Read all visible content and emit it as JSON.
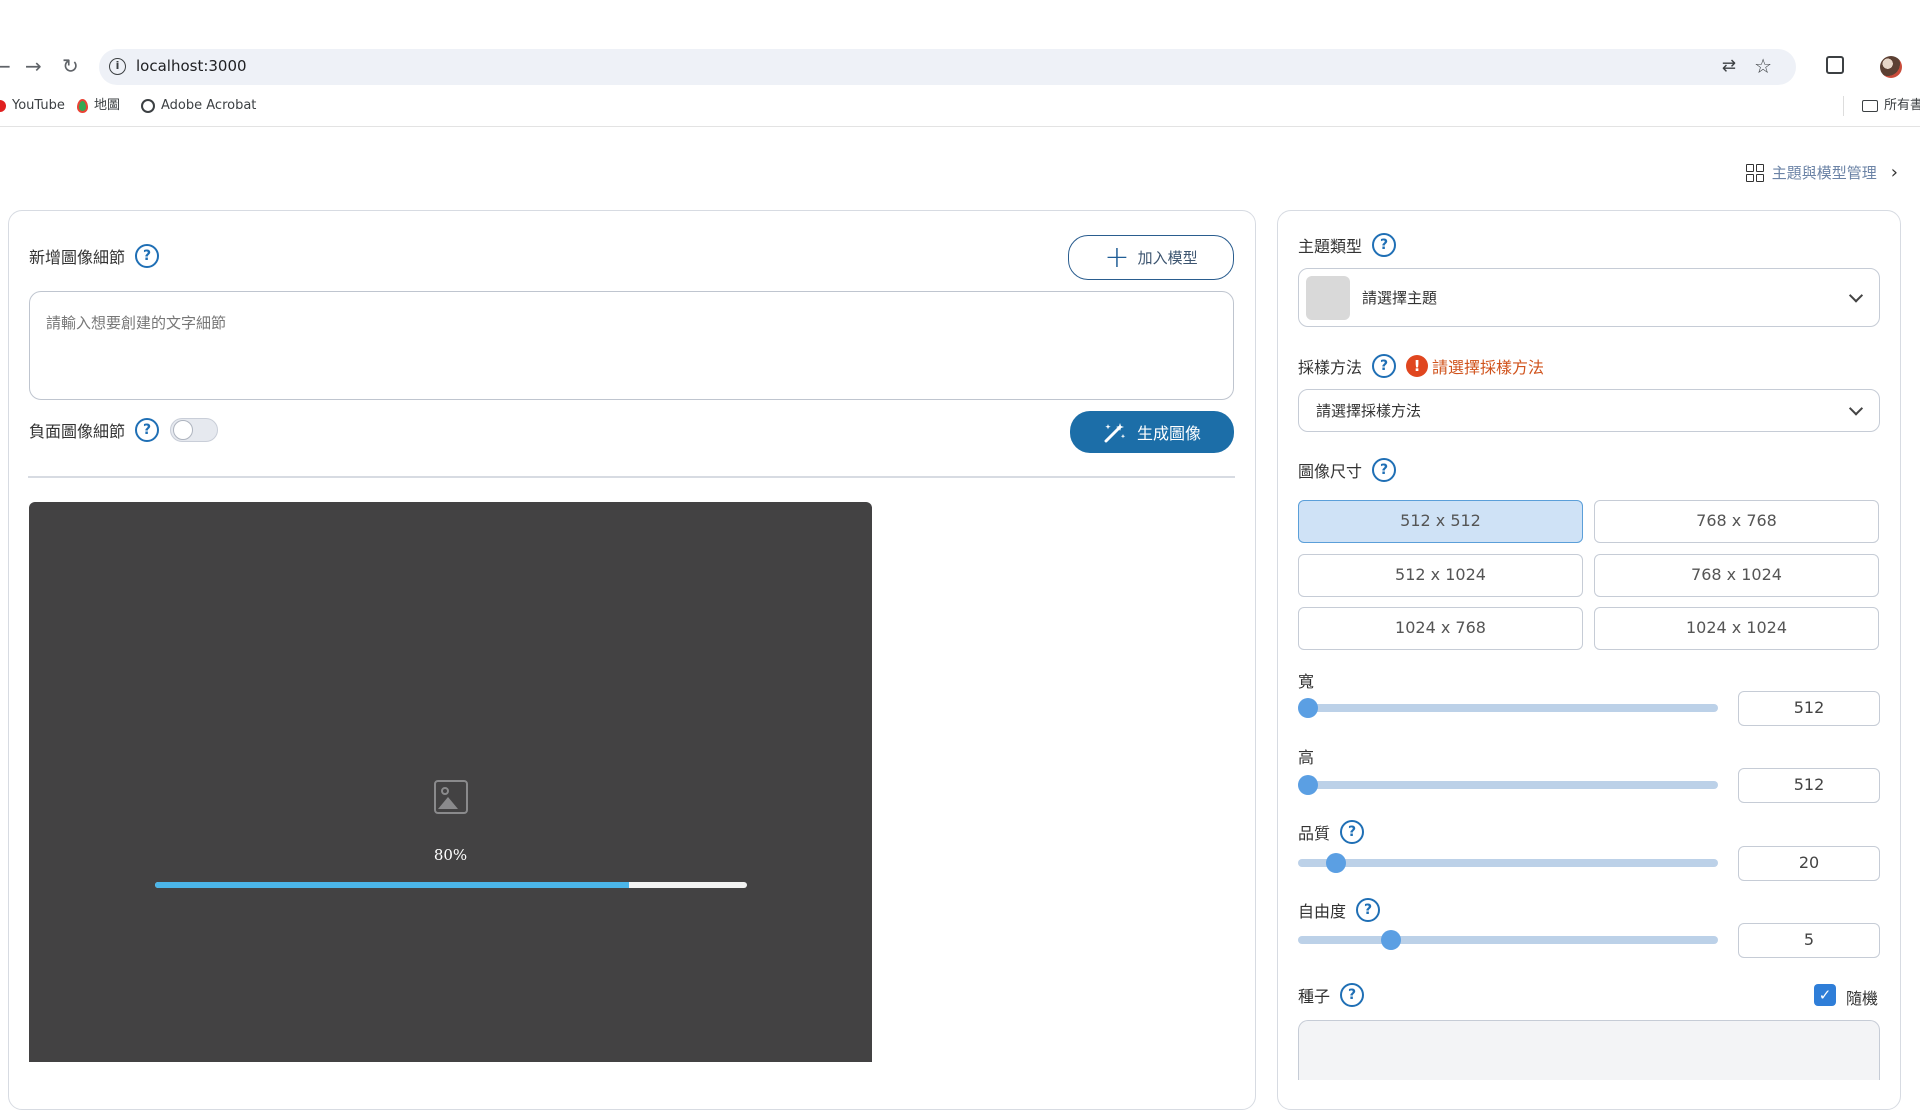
{
  "browser": {
    "url": "localhost:3000",
    "bookmarks": [
      "YouTube",
      "地圖",
      "Adobe Acrobat"
    ],
    "all_bookmarks": "所有書"
  },
  "header": {
    "manage_link": "主題與模型管理"
  },
  "left": {
    "details_label": "新增圖像細節",
    "add_model_button": "加入模型",
    "prompt_placeholder": "請輸入想要創建的文字細節",
    "negative_label": "負面圖像細節",
    "negative_enabled": false,
    "generate_button": "生成圖像",
    "progress_text": "80%",
    "progress_value": 0.8
  },
  "right": {
    "theme_type_label": "主題類型",
    "theme_select_placeholder": "請選擇主題",
    "sampling_label": "採樣方法",
    "sampling_error": "請選擇採樣方法",
    "sampling_select_placeholder": "請選擇採樣方法",
    "image_size_label": "圖像尺寸",
    "sizes": [
      "512 x 512",
      "768 x 768",
      "512 x 1024",
      "768 x 1024",
      "1024 x 768",
      "1024 x 1024"
    ],
    "selected_size": "512 x 512",
    "width_label": "寬",
    "width_value": "512",
    "height_label": "高",
    "height_value": "512",
    "quality_label": "品質",
    "quality_value": "20",
    "freedom_label": "自由度",
    "freedom_value": "5",
    "seed_label": "種子",
    "random_label": "隨機",
    "random_checked": true
  },
  "colors": {
    "primary": "#1c6ea8",
    "progress": "#4bb5e8",
    "error": "#e0461f",
    "selected_size_bg": "#cfe2f6",
    "slider_thumb": "#5b9fe3"
  },
  "icons": [
    "back-arrow-icon",
    "forward-arrow-icon",
    "reload-icon",
    "site-info-icon",
    "translate-icon",
    "star-icon",
    "extensions-icon",
    "profile-avatar",
    "grid-icon",
    "chevron-right-icon",
    "help-icon",
    "plus-icon",
    "magic-wand-icon",
    "image-placeholder-icon",
    "chevron-down-icon",
    "error-icon",
    "check-icon"
  ]
}
